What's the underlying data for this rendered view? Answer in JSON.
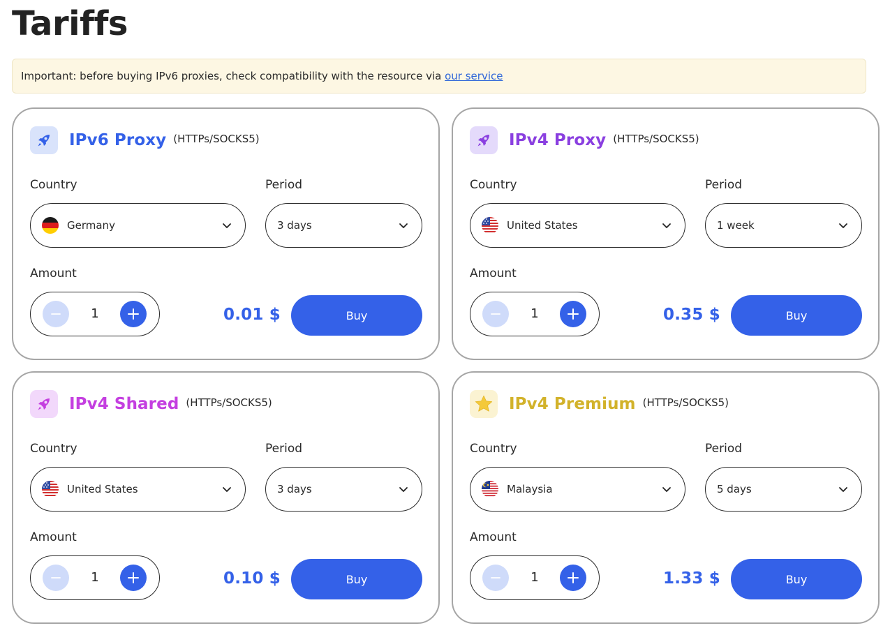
{
  "title": "Tariffs",
  "notice": {
    "text": "Important: before buying IPv6 proxies, check compatibility with the resource via ",
    "link": "our service"
  },
  "labels": {
    "country": "Country",
    "period": "Period",
    "amount": "Amount"
  },
  "cards": [
    {
      "name": "IPv6 Proxy",
      "protocol": "(HTTPs/SOCKS5)",
      "accent": "#3461e8",
      "icon": "rocket-icon",
      "country": "Germany",
      "period": "3 days",
      "amount": "1",
      "price": "0.01 $",
      "buy": "Buy"
    },
    {
      "name": "IPv4 Proxy",
      "protocol": "(HTTPs/SOCKS5)",
      "accent": "#8a3fe0",
      "icon": "rocket-icon",
      "country": "United States",
      "period": "1 week",
      "amount": "1",
      "price": "0.35 $",
      "buy": "Buy"
    },
    {
      "name": "IPv4 Shared",
      "protocol": "(HTTPs/SOCKS5)",
      "accent": "#c43fe0",
      "icon": "rocket-icon",
      "country": "United States",
      "period": "3 days",
      "amount": "1",
      "price": "0.10 $",
      "buy": "Buy"
    },
    {
      "name": "IPv4 Premium",
      "protocol": "(HTTPs/SOCKS5)",
      "accent": "#d2b22a",
      "icon": "star-icon",
      "country": "Malaysia",
      "period": "5 days",
      "amount": "1",
      "price": "1.33 $",
      "buy": "Buy"
    }
  ]
}
